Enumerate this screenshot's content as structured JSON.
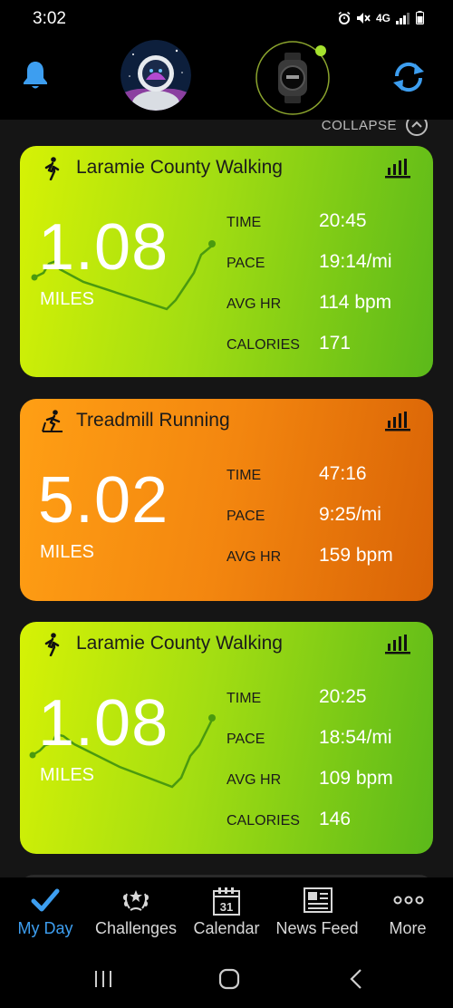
{
  "status_bar": {
    "time": "3:02",
    "network": "4G"
  },
  "header": {
    "icons": [
      "bell-icon",
      "profile-avatar",
      "watch-device",
      "sync-icon"
    ],
    "accent_color": "#3d9ef0",
    "device_connected_color": "#a6e22e"
  },
  "collapse": {
    "label": "COLLAPSE"
  },
  "activities": [
    {
      "title": "Laramie County Walking",
      "icon": "walking-icon",
      "distance": "1.08",
      "unit": "MILES",
      "stats": [
        {
          "label": "TIME",
          "value": "20:45"
        },
        {
          "label": "PACE",
          "value": "19:14/mi"
        },
        {
          "label": "AVG HR",
          "value": "114 bpm"
        },
        {
          "label": "CALORIES",
          "value": "171"
        }
      ]
    },
    {
      "title": "Treadmill Running",
      "icon": "treadmill-icon",
      "distance": "5.02",
      "unit": "MILES",
      "stats": [
        {
          "label": "TIME",
          "value": "47:16"
        },
        {
          "label": "PACE",
          "value": "9:25/mi"
        },
        {
          "label": "AVG HR",
          "value": "159 bpm"
        }
      ]
    },
    {
      "title": "Laramie County Walking",
      "icon": "walking-icon",
      "distance": "1.08",
      "unit": "MILES",
      "stats": [
        {
          "label": "TIME",
          "value": "20:25"
        },
        {
          "label": "PACE",
          "value": "18:54/mi"
        },
        {
          "label": "AVG HR",
          "value": "109 bpm"
        },
        {
          "label": "CALORIES",
          "value": "146"
        }
      ]
    }
  ],
  "bottom_nav": [
    {
      "label": "My Day",
      "icon": "checkmark-icon",
      "active": true
    },
    {
      "label": "Challenges",
      "icon": "laurel-icon",
      "active": false
    },
    {
      "label": "Calendar",
      "icon": "calendar-icon",
      "calendar_day": "31",
      "active": false
    },
    {
      "label": "News Feed",
      "icon": "newspaper-icon",
      "active": false
    },
    {
      "label": "More",
      "icon": "more-dots-icon",
      "active": false
    }
  ]
}
